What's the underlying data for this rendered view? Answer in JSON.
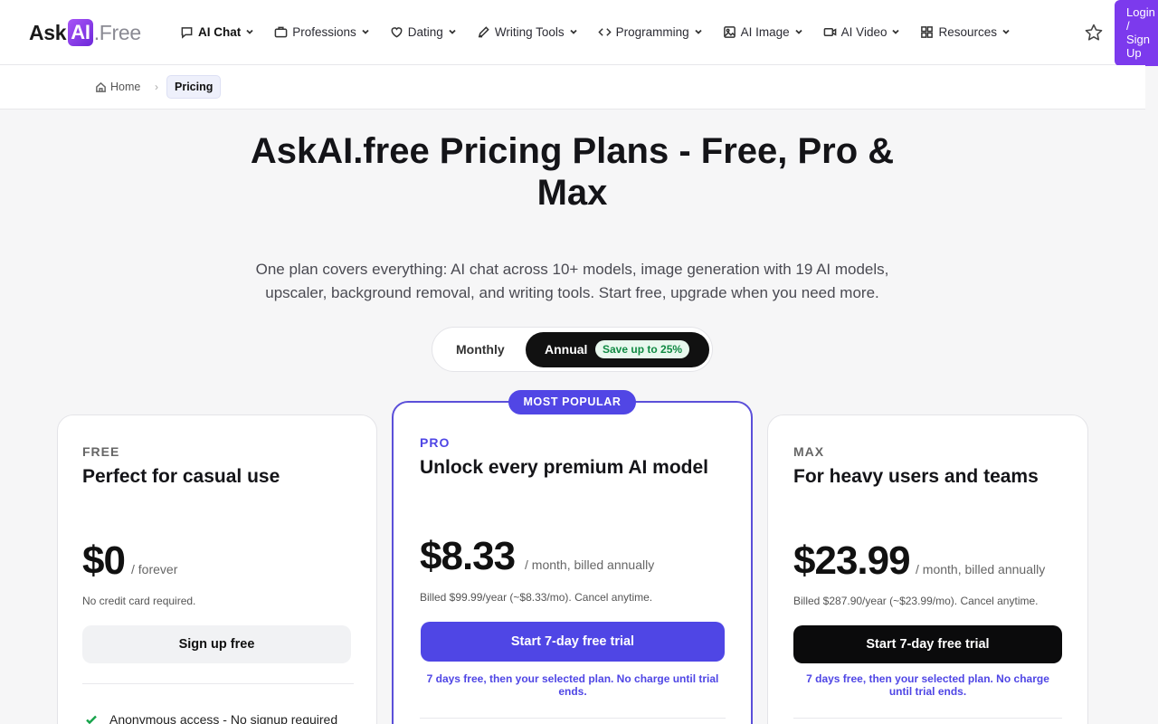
{
  "header": {
    "logo": {
      "ask": "Ask",
      "ai": "AI",
      "free": ".Free"
    },
    "nav": [
      {
        "label": "AI Chat",
        "icon": "chat-icon"
      },
      {
        "label": "Professions",
        "icon": "briefcase-icon"
      },
      {
        "label": "Dating",
        "icon": "heart-icon"
      },
      {
        "label": "Writing Tools",
        "icon": "pencil-icon"
      },
      {
        "label": "Programming",
        "icon": "code-icon"
      },
      {
        "label": "AI Image",
        "icon": "image-icon"
      },
      {
        "label": "AI Video",
        "icon": "video-icon"
      },
      {
        "label": "Resources",
        "icon": "grid-icon"
      }
    ],
    "login_label": "Login / Sign Up",
    "accent_color": "#7c3aed"
  },
  "breadcrumb": {
    "home": "Home",
    "current": "Pricing"
  },
  "hero": {
    "title": "AskAI.free Pricing Plans - Free, Pro & Max",
    "subtitle": "One plan covers everything: AI chat across 10+ models, image generation with 19 AI models, upscaler, background removal, and writing tools. Start free, upgrade when you need more."
  },
  "billing_toggle": {
    "monthly": "Monthly",
    "annual": "Annual",
    "save_badge": "Save up to 25%",
    "selected": "Annual"
  },
  "plans": {
    "free": {
      "tier": "FREE",
      "headline": "Perfect for casual use",
      "price": "$0",
      "period": "/ forever",
      "note": "No credit card required.",
      "cta": "Sign up free",
      "features": [
        "Anonymous access - No signup required"
      ]
    },
    "pro": {
      "badge": "MOST POPULAR",
      "tier": "PRO",
      "headline": "Unlock every premium AI model",
      "price": "$8.33",
      "period": "/ month, billed annually",
      "note": "Billed $99.99/year (~$8.33/mo). Cancel anytime.",
      "cta": "Start 7-day free trial",
      "trial_note": "7 days free, then your selected plan. No charge until trial ends.",
      "color": "#4f46e5"
    },
    "max": {
      "tier": "MAX",
      "headline": "For heavy users and teams",
      "price": "$23.99",
      "period": "/ month, billed annually",
      "note": "Billed $287.90/year (~$23.99/mo). Cancel anytime.",
      "cta": "Start 7-day free trial",
      "trial_note": "7 days free, then your selected plan. No charge until trial ends."
    }
  }
}
